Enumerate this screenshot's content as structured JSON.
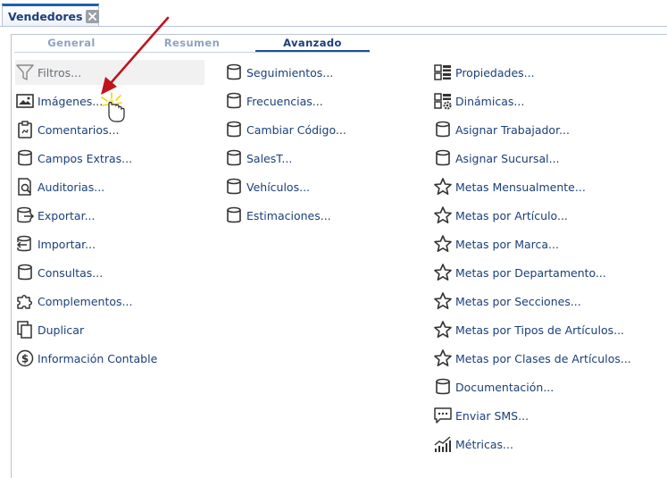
{
  "window": {
    "tab_title": "Vendedores"
  },
  "subtabs": [
    "General",
    "Resumen",
    "Avanzado"
  ],
  "columns": [
    [
      {
        "label": "Filtros...",
        "icon": "filter-icon"
      },
      {
        "label": "Imágenes...",
        "icon": "image-icon"
      },
      {
        "label": "Comentarios...",
        "icon": "clipboard-icon"
      },
      {
        "label": "Campos Extras...",
        "icon": "database-icon"
      },
      {
        "label": "Auditorias...",
        "icon": "audit-icon"
      },
      {
        "label": "Exportar...",
        "icon": "export-icon"
      },
      {
        "label": "Importar...",
        "icon": "import-icon"
      },
      {
        "label": "Consultas...",
        "icon": "database-icon"
      },
      {
        "label": "Complementos...",
        "icon": "puzzle-icon"
      },
      {
        "label": "Duplicar",
        "icon": "copy-icon"
      },
      {
        "label": "Información Contable",
        "icon": "dollar-icon"
      }
    ],
    [
      {
        "label": "Seguimientos...",
        "icon": "database-icon"
      },
      {
        "label": "Frecuencias...",
        "icon": "database-icon"
      },
      {
        "label": "Cambiar Código...",
        "icon": "database-icon"
      },
      {
        "label": "SalesT...",
        "icon": "database-icon"
      },
      {
        "label": "Vehículos...",
        "icon": "database-icon"
      },
      {
        "label": "Estimaciones...",
        "icon": "database-icon"
      }
    ],
    [
      {
        "label": "Propiedades...",
        "icon": "properties-icon"
      },
      {
        "label": "Dinámicas...",
        "icon": "dynamic-icon"
      },
      {
        "label": "Asignar Trabajador...",
        "icon": "database-icon"
      },
      {
        "label": "Asignar Sucursal...",
        "icon": "database-icon"
      },
      {
        "label": "Metas Mensualmente...",
        "icon": "star-icon"
      },
      {
        "label": "Metas por Artículo...",
        "icon": "star-icon"
      },
      {
        "label": "Metas por Marca...",
        "icon": "star-icon"
      },
      {
        "label": "Metas por Departamento...",
        "icon": "star-icon"
      },
      {
        "label": "Metas por Secciones...",
        "icon": "star-icon"
      },
      {
        "label": "Metas por Tipos de Artículos...",
        "icon": "star-icon"
      },
      {
        "label": "Metas por Clases de Artículos...",
        "icon": "star-icon"
      },
      {
        "label": "Documentación...",
        "icon": "database-icon"
      },
      {
        "label": "Enviar SMS...",
        "icon": "sms-icon"
      },
      {
        "label": "Métricas...",
        "icon": "chart-icon"
      }
    ]
  ],
  "colors": {
    "accent": "#1f5fae",
    "text": "#1a3f7a",
    "arrow": "#c0141c",
    "icon": "#333333"
  }
}
